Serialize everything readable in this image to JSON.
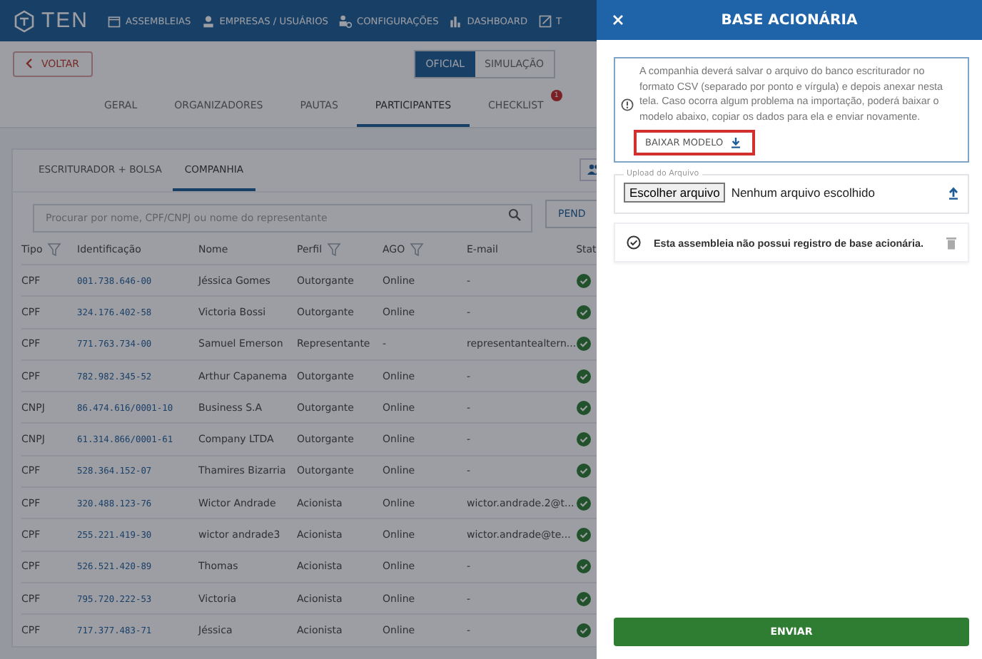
{
  "header": {
    "logo": "TEN",
    "nav": [
      {
        "label": "ASSEMBLEIAS"
      },
      {
        "label": "EMPRESAS / USUÁRIOS"
      },
      {
        "label": "CONFIGURAÇÕES"
      },
      {
        "label": "DASHBOARD"
      },
      {
        "label": "T"
      }
    ]
  },
  "back_button": "VOLTAR",
  "mode_toggle": [
    {
      "label": "OFICIAL",
      "selected": true
    },
    {
      "label": "SIMULAÇÃO",
      "selected": false
    }
  ],
  "tabs": [
    {
      "label": "GERAL",
      "selected": false
    },
    {
      "label": "ORGANIZADORES",
      "selected": false
    },
    {
      "label": "PAUTAS",
      "selected": false
    },
    {
      "label": "PARTICIPANTES",
      "selected": true
    },
    {
      "label": "CHECKLIST",
      "selected": false,
      "badge": "1"
    }
  ],
  "sub_tabs": [
    {
      "label": "ESCRITURADOR + BOLSA",
      "selected": false
    },
    {
      "label": "COMPANHIA",
      "selected": true
    }
  ],
  "search": {
    "placeholder": "Procurar por nome, CPF/CNPJ ou nome do representante"
  },
  "pending_button": "PEND",
  "table": {
    "columns": [
      {
        "label": "Tipo",
        "filter": true
      },
      {
        "label": "Identificação",
        "filter": false
      },
      {
        "label": "Nome",
        "filter": false
      },
      {
        "label": "Perfil",
        "filter": true
      },
      {
        "label": "AGO",
        "filter": true
      },
      {
        "label": "E-mail",
        "filter": false
      },
      {
        "label": "Stat",
        "filter": false
      }
    ],
    "rows": [
      [
        "CPF",
        "001.738.646-00",
        "Jéssica Gomes",
        "Outorgante",
        "Online",
        "-"
      ],
      [
        "CPF",
        "324.176.402-58",
        "Victoria Bossi",
        "Outorgante",
        "Online",
        "-"
      ],
      [
        "CPF",
        "771.763.734-00",
        "Samuel Emerson",
        "Representante",
        "-",
        "representantealtern..."
      ],
      [
        "CPF",
        "782.982.345-52",
        "Arthur Capanema",
        "Outorgante",
        "Online",
        "-"
      ],
      [
        "CNPJ",
        "86.474.616/0001-10",
        "Business S.A",
        "Outorgante",
        "Online",
        "-"
      ],
      [
        "CNPJ",
        "61.314.866/0001-61",
        "Company LTDA",
        "Outorgante",
        "Online",
        "-"
      ],
      [
        "CPF",
        "528.364.152-07",
        "Thamires Bizarria",
        "Outorgante",
        "Online",
        "-"
      ],
      [
        "CPF",
        "320.488.123-76",
        "Wictor Andrade",
        "Acionista",
        "Online",
        "wictor.andrade.2@t..."
      ],
      [
        "CPF",
        "255.221.419-30",
        "wictor andrade3",
        "Acionista",
        "Online",
        "wictor.andrade@te..."
      ],
      [
        "CPF",
        "526.521.420-89",
        "Thomas",
        "Acionista",
        "Online",
        "-"
      ],
      [
        "CPF",
        "795.720.222-53",
        "Victoria",
        "Acionista",
        "Online",
        "-"
      ],
      [
        "CPF",
        "717.377.483-71",
        "Jéssica",
        "Acionista",
        "Online",
        "-"
      ]
    ]
  },
  "drawer": {
    "title": "BASE ACIONÁRIA",
    "info_text": "A companhia deverá salvar o arquivo do banco escriturador no formato CSV (separado por ponto e vírgula) e depois anexar nesta tela. Caso ocorra algum problema na importação, poderá baixar o modelo abaixo, copiar os dados para ela e enviar novamente.",
    "download_link": "BAIXAR MODELO",
    "upload": {
      "label": "Upload do Arquivo",
      "button": "Escolher arquivo",
      "value": "Nenhum arquivo escolhido"
    },
    "status_message": "Esta assembleia não possui registro de base acionária.",
    "submit_button": "ENVIAR"
  }
}
